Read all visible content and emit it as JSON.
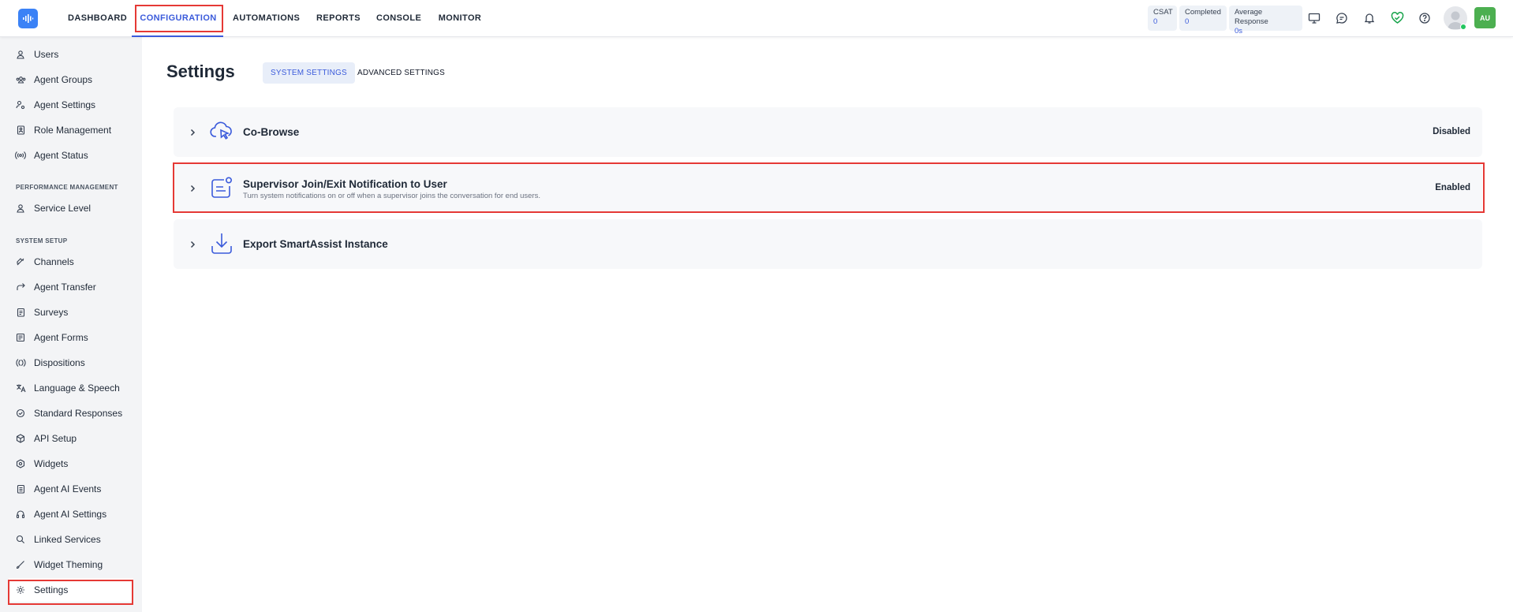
{
  "nav": {
    "items": [
      {
        "label": "DASHBOARD"
      },
      {
        "label": "CONFIGURATION"
      },
      {
        "label": "AUTOMATIONS"
      },
      {
        "label": "REPORTS"
      },
      {
        "label": "CONSOLE"
      },
      {
        "label": "MONITOR"
      }
    ],
    "active": "CONFIGURATION"
  },
  "stats": [
    {
      "label": "CSAT",
      "value": "0"
    },
    {
      "label": "Completed",
      "value": "0"
    },
    {
      "label": "Average Response",
      "value": "0s"
    }
  ],
  "topbar_icons": [
    "monitor-icon",
    "chat-icon",
    "bell-icon",
    "heart-check-icon",
    "help-icon"
  ],
  "user": {
    "initials": "AU",
    "status": "online"
  },
  "sidebar": {
    "items_top": [
      {
        "label": "Users",
        "icon": "users-icon"
      },
      {
        "label": "Agent Groups",
        "icon": "agent-groups-icon"
      },
      {
        "label": "Agent Settings",
        "icon": "agent-settings-icon"
      },
      {
        "label": "Role Management",
        "icon": "role-management-icon"
      },
      {
        "label": "Agent Status",
        "icon": "agent-status-icon"
      }
    ],
    "section_performance": "PERFORMANCE MANAGEMENT",
    "items_performance": [
      {
        "label": "Service Level",
        "icon": "service-level-icon"
      }
    ],
    "section_system": "SYSTEM SETUP",
    "items_system": [
      {
        "label": "Channels",
        "icon": "channels-icon"
      },
      {
        "label": "Agent Transfer",
        "icon": "agent-transfer-icon"
      },
      {
        "label": "Surveys",
        "icon": "surveys-icon"
      },
      {
        "label": "Agent Forms",
        "icon": "agent-forms-icon"
      },
      {
        "label": "Dispositions",
        "icon": "dispositions-icon"
      },
      {
        "label": "Language & Speech",
        "icon": "language-icon"
      },
      {
        "label": "Standard Responses",
        "icon": "standard-responses-icon"
      },
      {
        "label": "API Setup",
        "icon": "api-setup-icon"
      },
      {
        "label": "Widgets",
        "icon": "widgets-icon"
      },
      {
        "label": "Agent AI Events",
        "icon": "agent-ai-events-icon"
      },
      {
        "label": "Agent AI Settings",
        "icon": "agent-ai-settings-icon"
      },
      {
        "label": "Linked Services",
        "icon": "linked-services-icon"
      },
      {
        "label": "Widget Theming",
        "icon": "widget-theming-icon"
      },
      {
        "label": "Settings",
        "icon": "settings-icon"
      }
    ]
  },
  "main": {
    "title": "Settings",
    "tabs": [
      {
        "label": "SYSTEM SETTINGS"
      },
      {
        "label": "ADVANCED SETTINGS"
      }
    ],
    "active_tab": "SYSTEM SETTINGS",
    "cards": [
      {
        "title": "Co-Browse",
        "description": "",
        "status": "Disabled",
        "icon": "cloud-cursor-icon"
      },
      {
        "title": "Supervisor Join/Exit Notification to User",
        "description": "Turn system notifications on or off when a supervisor joins the conversation for end users.",
        "status": "Enabled",
        "icon": "notification-card-icon"
      },
      {
        "title": "Export SmartAssist Instance",
        "description": "",
        "status": "",
        "icon": "download-icon"
      }
    ]
  },
  "colors": {
    "accent": "#3b5bdb",
    "logo": "#3b82f6",
    "highlight": "#e53935",
    "user_badge": "#4caf50",
    "online": "#22c55e"
  }
}
